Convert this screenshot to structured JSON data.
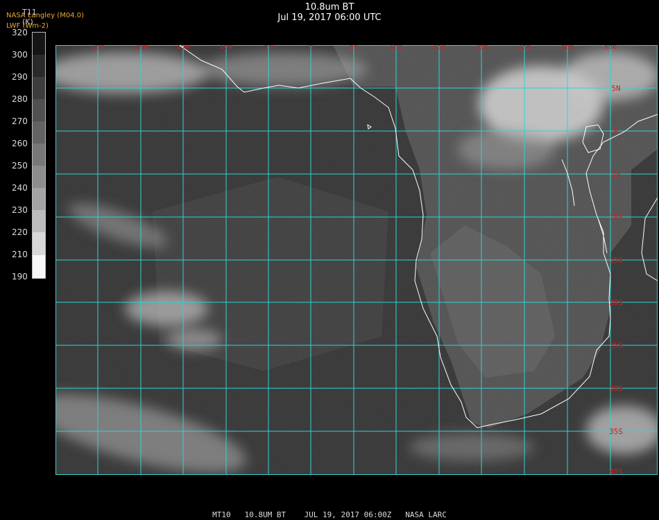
{
  "header": {
    "title": "10.8um BT",
    "datetime": "Jul 19, 2017 06:00 UTC",
    "org_line1": "NASA Langley (M04.0)",
    "org_line2": "LWF (Wm-2)"
  },
  "colorbar": {
    "title": "T11",
    "unit": "(K)",
    "ticks": [
      "320",
      "300",
      "290",
      "280",
      "270",
      "260",
      "250",
      "240",
      "230",
      "220",
      "210",
      "190"
    ]
  },
  "map": {
    "longitude_labels": [
      "25W",
      "20W",
      "15W",
      "10W",
      "5W",
      "0",
      "5E",
      "10E",
      "15E",
      "20E",
      "25E",
      "30E",
      "35E"
    ],
    "latitude_labels": [
      "5N",
      "0",
      "5S",
      "10S",
      "15S",
      "20S",
      "25S",
      "30S",
      "35S",
      "40S"
    ],
    "grid_color": "#2fd4d4",
    "label_color": "#d02020",
    "coast_color": "#ffffff"
  },
  "footer": {
    "text": "MT10   10.8UM BT    JUL 19, 2017 06:00Z   NASA LARC"
  }
}
